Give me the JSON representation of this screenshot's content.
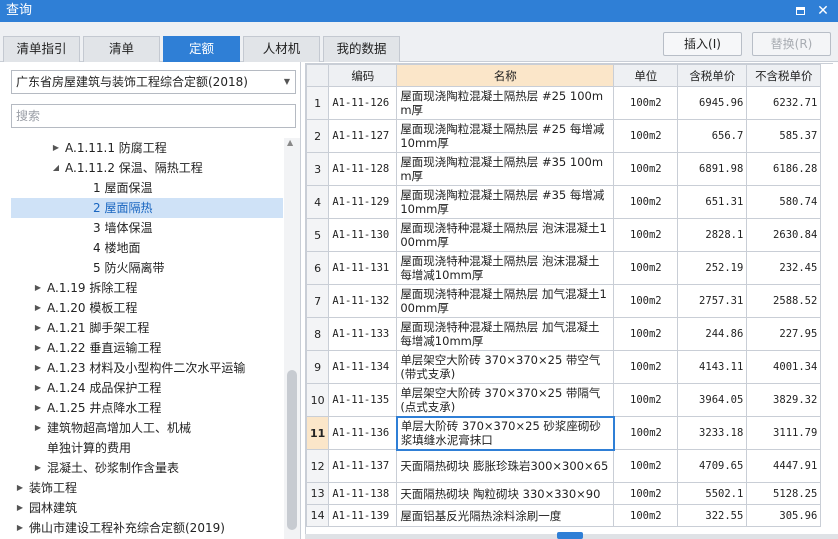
{
  "window": {
    "title": "查询"
  },
  "tabs": [
    {
      "label": "清单指引",
      "active": false
    },
    {
      "label": "清单",
      "active": false
    },
    {
      "label": "定额",
      "active": true
    },
    {
      "label": "人材机",
      "active": false
    },
    {
      "label": "我的数据",
      "active": false
    }
  ],
  "toolbar": {
    "insert_label": "插入(I)",
    "replace_label": "替换(R)"
  },
  "left": {
    "library_selected": "广东省房屋建筑与装饰工程综合定额(2018)",
    "search_placeholder": "搜索",
    "tree": [
      {
        "label": "A.1.11.1 防腐工程",
        "arrow": "▶",
        "level": 4,
        "selected": false
      },
      {
        "label": "A.1.11.2 保温、隔热工程",
        "arrow": "◢",
        "level": 4,
        "selected": false
      },
      {
        "label": "1 屋面保温",
        "arrow": "",
        "level": 5,
        "selected": false
      },
      {
        "label": "2 屋面隔热",
        "arrow": "",
        "level": 5,
        "selected": true
      },
      {
        "label": "3 墙体保温",
        "arrow": "",
        "level": 5,
        "selected": false
      },
      {
        "label": "4 楼地面",
        "arrow": "",
        "level": 5,
        "selected": false
      },
      {
        "label": "5 防火隔离带",
        "arrow": "",
        "level": 5,
        "selected": false
      },
      {
        "label": "A.1.19 拆除工程",
        "arrow": "▶",
        "level": 2,
        "selected": false
      },
      {
        "label": "A.1.20 模板工程",
        "arrow": "▶",
        "level": 2,
        "selected": false
      },
      {
        "label": "A.1.21 脚手架工程",
        "arrow": "▶",
        "level": 2,
        "selected": false
      },
      {
        "label": "A.1.22 垂直运输工程",
        "arrow": "▶",
        "level": 2,
        "selected": false
      },
      {
        "label": "A.1.23 材料及小型构件二次水平运输",
        "arrow": "▶",
        "level": 2,
        "selected": false
      },
      {
        "label": "A.1.24 成品保护工程",
        "arrow": "▶",
        "level": 2,
        "selected": false
      },
      {
        "label": "A.1.25 井点降水工程",
        "arrow": "▶",
        "level": 2,
        "selected": false
      },
      {
        "label": "建筑物超高增加人工、机械",
        "arrow": "▶",
        "level": 2,
        "selected": false
      },
      {
        "label": "单独计算的费用",
        "arrow": "",
        "level": 2,
        "selected": false
      },
      {
        "label": "混凝土、砂浆制作含量表",
        "arrow": "▶",
        "level": 2,
        "selected": false
      },
      {
        "label": "装饰工程",
        "arrow": "▶",
        "level": 1,
        "selected": false
      },
      {
        "label": "园林建筑",
        "arrow": "▶",
        "level": 1,
        "selected": false
      },
      {
        "label": "佛山市建设工程补充综合定额(2019)",
        "arrow": "▶",
        "level": 1,
        "selected": false
      }
    ]
  },
  "table": {
    "headers": [
      "",
      "编码",
      "名称",
      "单位",
      "含税单价",
      "不含税单价"
    ],
    "rows": [
      {
        "idx": "1",
        "code": "A1-11-126",
        "name": "屋面现浇陶粒混凝土隔热层 #25 100mm厚",
        "unit": "100m2",
        "price_tax": "6945.96",
        "price_notax": "6232.71"
      },
      {
        "idx": "2",
        "code": "A1-11-127",
        "name": "屋面现浇陶粒混凝土隔热层 #25 每增减10mm厚",
        "unit": "100m2",
        "price_tax": "656.7",
        "price_notax": "585.37"
      },
      {
        "idx": "3",
        "code": "A1-11-128",
        "name": "屋面现浇陶粒混凝土隔热层 #35 100mm厚",
        "unit": "100m2",
        "price_tax": "6891.98",
        "price_notax": "6186.28"
      },
      {
        "idx": "4",
        "code": "A1-11-129",
        "name": "屋面现浇陶粒混凝土隔热层 #35 每增减10mm厚",
        "unit": "100m2",
        "price_tax": "651.31",
        "price_notax": "580.74"
      },
      {
        "idx": "5",
        "code": "A1-11-130",
        "name": "屋面现浇特种混凝土隔热层 泡沫混凝土100mm厚",
        "unit": "100m2",
        "price_tax": "2828.1",
        "price_notax": "2630.84"
      },
      {
        "idx": "6",
        "code": "A1-11-131",
        "name": "屋面现浇特种混凝土隔热层 泡沫混凝土每增减10mm厚",
        "unit": "100m2",
        "price_tax": "252.19",
        "price_notax": "232.45"
      },
      {
        "idx": "7",
        "code": "A1-11-132",
        "name": "屋面现浇特种混凝土隔热层 加气混凝土100mm厚",
        "unit": "100m2",
        "price_tax": "2757.31",
        "price_notax": "2588.52"
      },
      {
        "idx": "8",
        "code": "A1-11-133",
        "name": "屋面现浇特种混凝土隔热层 加气混凝土每增减10mm厚",
        "unit": "100m2",
        "price_tax": "244.86",
        "price_notax": "227.95"
      },
      {
        "idx": "9",
        "code": "A1-11-134",
        "name": "单层架空大阶砖 370×370×25 带空气(带式支承)",
        "unit": "100m2",
        "price_tax": "4143.11",
        "price_notax": "4001.34"
      },
      {
        "idx": "10",
        "code": "A1-11-135",
        "name": "单层架空大阶砖 370×370×25 带隔气(点式支承)",
        "unit": "100m2",
        "price_tax": "3964.05",
        "price_notax": "3829.32"
      },
      {
        "idx": "11",
        "code": "A1-11-136",
        "name": "单层大阶砖 370×370×25 砂浆座砌砂浆填缝水泥膏抹口",
        "unit": "100m2",
        "price_tax": "3233.18",
        "price_notax": "3111.79",
        "current": true
      },
      {
        "idx": "12",
        "code": "A1-11-137",
        "name": "天面隔热砌块 膨胀珍珠岩300×300×65",
        "unit": "100m2",
        "price_tax": "4709.65",
        "price_notax": "4447.91"
      },
      {
        "idx": "13",
        "code": "A1-11-138",
        "name": "天面隔热砌块 陶粒砌块 330×330×90",
        "unit": "100m2",
        "price_tax": "5502.1",
        "price_notax": "5128.25",
        "short": true
      },
      {
        "idx": "14",
        "code": "A1-11-139",
        "name": "屋面铝基反光隔热涂料涂刷一度",
        "unit": "100m2",
        "price_tax": "322.55",
        "price_notax": "305.96",
        "short": true
      }
    ]
  }
}
